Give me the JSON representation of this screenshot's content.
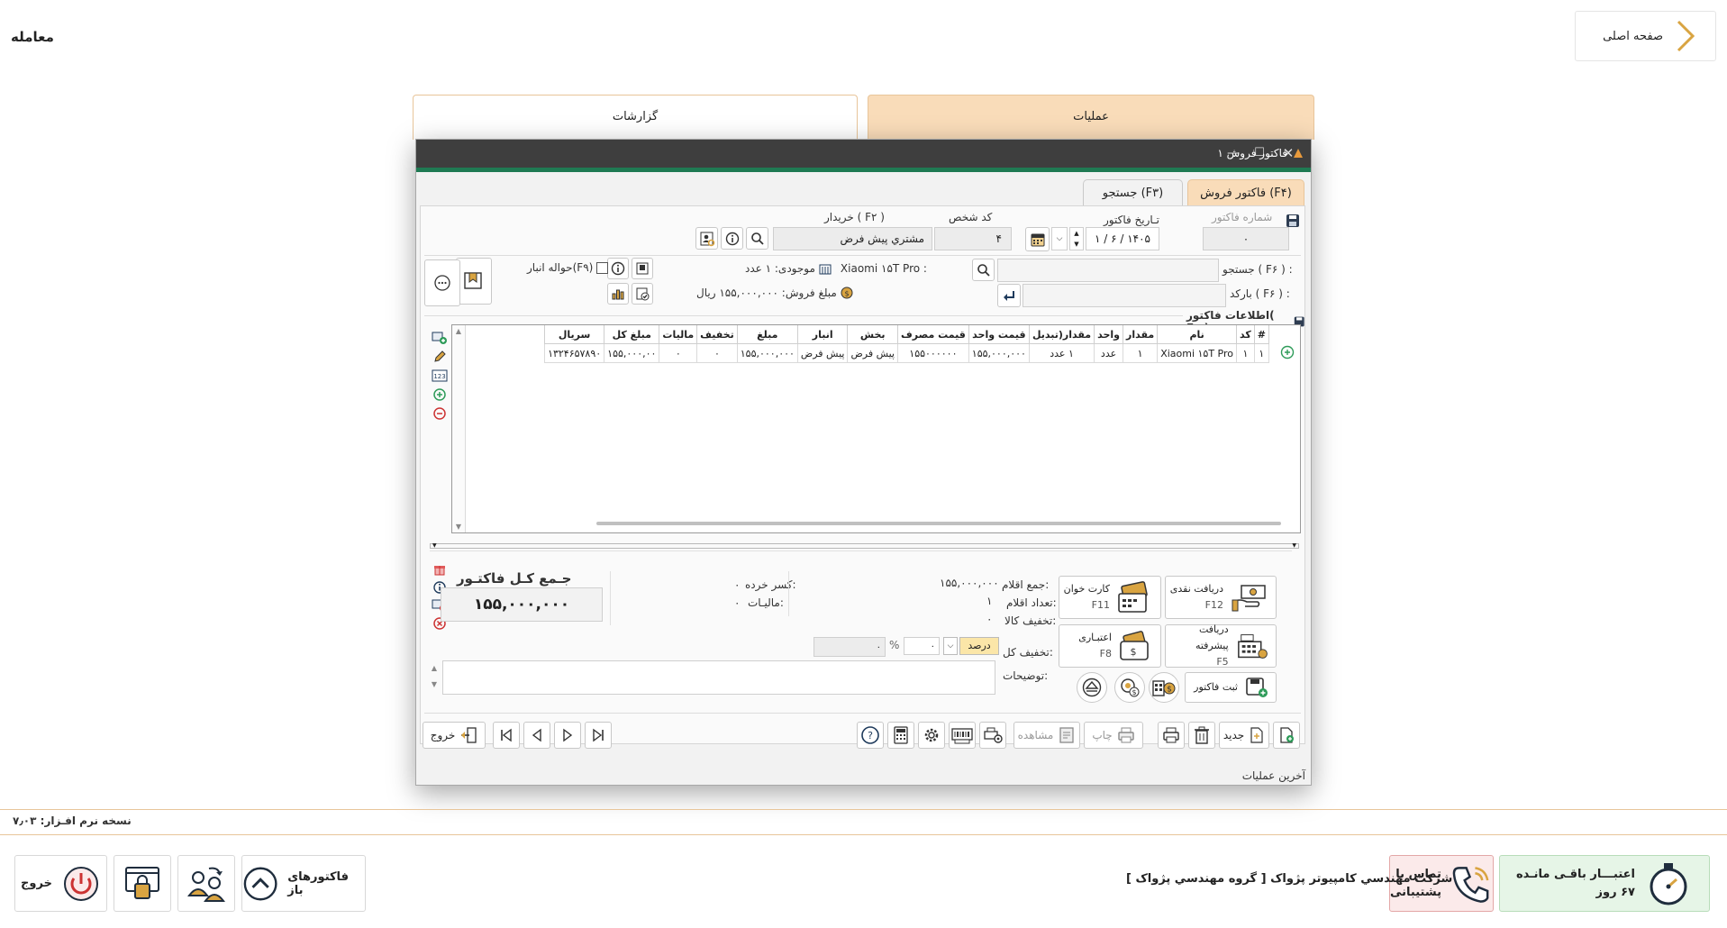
{
  "header": {
    "home_label": "صفحه اصلی",
    "page_title": "معامله"
  },
  "top_tabs": {
    "operations": "عملیات",
    "reports": "گزارشات"
  },
  "window": {
    "title": "فاکتور فروش ۱",
    "tabs": {
      "invoice": "فاکتور فروش (F۴)",
      "search": "جستجو (F۳)"
    },
    "invoice_number_label": "شماره فاکتور",
    "invoice_number": "۰",
    "invoice_date_label": "تـاریخ فاکتور",
    "invoice_date": "۱ / ۶ / ۱۴۰۵",
    "person_code_label": "کد شخص",
    "person_code": "۴",
    "buyer_label": "خریدار ( F۲ )",
    "buyer": "مشتري پيش فرض",
    "search_label": "جستجو ( F۶ ) :",
    "barcode_label": "بارکد ( F۶ ) :",
    "product_name": "Xiaomi ۱۵T Pro :",
    "stock_label": "موجودی: ۱ عدد",
    "sale_price_label": "مبلغ فروش: ۱۵۵,۰۰۰,۰۰۰ ریال",
    "warehouse_remit_label": "حواله انبار(F۹)",
    "section_title": "اطلاعات فاکتور( F۷ )",
    "table": {
      "headers": [
        "#",
        "کد",
        "نام",
        "مقدار",
        "واحد",
        "مقدار(تبدیل",
        "قیمت واحد",
        "قیمت مصرف",
        "بخش",
        "انبار",
        "مبلغ",
        "تخفیف",
        "مالیات",
        "مبلغ کل",
        "سریال"
      ],
      "rows": [
        [
          "۱",
          "۱",
          "Xiaomi ۱۵T Pro",
          "۱",
          "عدد",
          "۱ عدد",
          "۱۵۵,۰۰۰,۰۰۰",
          "۱۵۵۰۰۰۰۰۰",
          "پيش فرض",
          "پيش فرض",
          "۱۵۵,۰۰۰,۰۰۰",
          "۰",
          "۰",
          "۱۵۵,۰۰۰,۰۰",
          "۱۳۲۴۶۵۷۸۹۰"
        ]
      ]
    },
    "summary": {
      "items_total_label": "جمع اقلام:",
      "items_total": "۱۵۵,۰۰۰,۰۰۰",
      "items_count_label": "تعداد اقلام:",
      "items_count": "۱",
      "goods_discount_label": "تخفیف کالا:",
      "goods_discount": "۰",
      "retail_deduction_label": "کسر خرده:",
      "retail_deduction": "۰",
      "tax_label": "مالیـات:",
      "tax": "۰",
      "grand_total_label": "جـمع کـل فاکتـور",
      "grand_total": "۱۵۵,۰۰۰,۰۰۰",
      "total_discount_label": "تخفیف کل:",
      "discount_type": "درصد",
      "discount_percent": "۰",
      "discount_amount": "۰",
      "notes_label": "توضیحات:"
    },
    "payments": {
      "cash": {
        "label": "دریافت نقدی",
        "key": "F12"
      },
      "card": {
        "label": "کارت خوان",
        "key": "F11"
      },
      "advanced": {
        "label": "دریافت پیشرفته",
        "key": "F5"
      },
      "credit": {
        "label": "اعتبـاری",
        "key": "F8"
      },
      "save": {
        "label": "ثبت فاکتور"
      }
    },
    "toolbar": {
      "new": "جدید",
      "print": "چاپ",
      "view": "مشاهده",
      "exit": "خروج"
    },
    "last_ops": "آخرین عملیات"
  },
  "footer": {
    "version": "نسخه نرم افـزار: ۷٫۰۳",
    "credit_label": "اعتبـــار باقـی مانـده",
    "credit_days": "۶۷ روز",
    "support_label_1": "تماس با",
    "support_label_2": "پشتیبانی",
    "company": "شرکت مهندسي کامپيوتر پژواک [ گروه مهندسي پژواک ]",
    "open_invoices": "فاکتورهای باز",
    "exit": "خروج"
  },
  "colors": {
    "accent": "#f9dcb9",
    "accent_border": "#e8c59a",
    "title_bar": "#3e3e3e",
    "green_line": "#1f7a53",
    "credit_bg": "#e6f5e7",
    "icon_gold": "#d9a441",
    "icon_dark": "#1f2d3d"
  }
}
